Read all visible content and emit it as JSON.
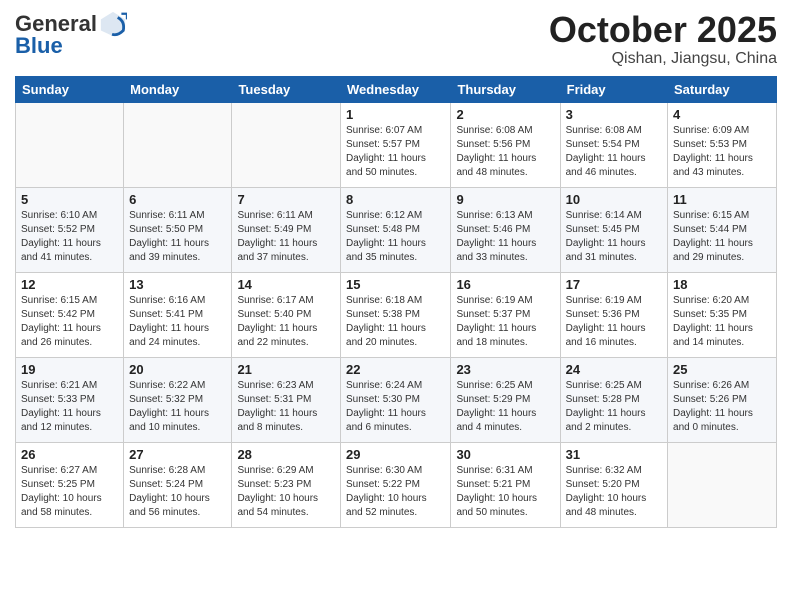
{
  "header": {
    "logo_general": "General",
    "logo_blue": "Blue",
    "month": "October 2025",
    "location": "Qishan, Jiangsu, China"
  },
  "days_of_week": [
    "Sunday",
    "Monday",
    "Tuesday",
    "Wednesday",
    "Thursday",
    "Friday",
    "Saturday"
  ],
  "weeks": [
    [
      {
        "day": "",
        "detail": ""
      },
      {
        "day": "",
        "detail": ""
      },
      {
        "day": "",
        "detail": ""
      },
      {
        "day": "1",
        "detail": "Sunrise: 6:07 AM\nSunset: 5:57 PM\nDaylight: 11 hours\nand 50 minutes."
      },
      {
        "day": "2",
        "detail": "Sunrise: 6:08 AM\nSunset: 5:56 PM\nDaylight: 11 hours\nand 48 minutes."
      },
      {
        "day": "3",
        "detail": "Sunrise: 6:08 AM\nSunset: 5:54 PM\nDaylight: 11 hours\nand 46 minutes."
      },
      {
        "day": "4",
        "detail": "Sunrise: 6:09 AM\nSunset: 5:53 PM\nDaylight: 11 hours\nand 43 minutes."
      }
    ],
    [
      {
        "day": "5",
        "detail": "Sunrise: 6:10 AM\nSunset: 5:52 PM\nDaylight: 11 hours\nand 41 minutes."
      },
      {
        "day": "6",
        "detail": "Sunrise: 6:11 AM\nSunset: 5:50 PM\nDaylight: 11 hours\nand 39 minutes."
      },
      {
        "day": "7",
        "detail": "Sunrise: 6:11 AM\nSunset: 5:49 PM\nDaylight: 11 hours\nand 37 minutes."
      },
      {
        "day": "8",
        "detail": "Sunrise: 6:12 AM\nSunset: 5:48 PM\nDaylight: 11 hours\nand 35 minutes."
      },
      {
        "day": "9",
        "detail": "Sunrise: 6:13 AM\nSunset: 5:46 PM\nDaylight: 11 hours\nand 33 minutes."
      },
      {
        "day": "10",
        "detail": "Sunrise: 6:14 AM\nSunset: 5:45 PM\nDaylight: 11 hours\nand 31 minutes."
      },
      {
        "day": "11",
        "detail": "Sunrise: 6:15 AM\nSunset: 5:44 PM\nDaylight: 11 hours\nand 29 minutes."
      }
    ],
    [
      {
        "day": "12",
        "detail": "Sunrise: 6:15 AM\nSunset: 5:42 PM\nDaylight: 11 hours\nand 26 minutes."
      },
      {
        "day": "13",
        "detail": "Sunrise: 6:16 AM\nSunset: 5:41 PM\nDaylight: 11 hours\nand 24 minutes."
      },
      {
        "day": "14",
        "detail": "Sunrise: 6:17 AM\nSunset: 5:40 PM\nDaylight: 11 hours\nand 22 minutes."
      },
      {
        "day": "15",
        "detail": "Sunrise: 6:18 AM\nSunset: 5:38 PM\nDaylight: 11 hours\nand 20 minutes."
      },
      {
        "day": "16",
        "detail": "Sunrise: 6:19 AM\nSunset: 5:37 PM\nDaylight: 11 hours\nand 18 minutes."
      },
      {
        "day": "17",
        "detail": "Sunrise: 6:19 AM\nSunset: 5:36 PM\nDaylight: 11 hours\nand 16 minutes."
      },
      {
        "day": "18",
        "detail": "Sunrise: 6:20 AM\nSunset: 5:35 PM\nDaylight: 11 hours\nand 14 minutes."
      }
    ],
    [
      {
        "day": "19",
        "detail": "Sunrise: 6:21 AM\nSunset: 5:33 PM\nDaylight: 11 hours\nand 12 minutes."
      },
      {
        "day": "20",
        "detail": "Sunrise: 6:22 AM\nSunset: 5:32 PM\nDaylight: 11 hours\nand 10 minutes."
      },
      {
        "day": "21",
        "detail": "Sunrise: 6:23 AM\nSunset: 5:31 PM\nDaylight: 11 hours\nand 8 minutes."
      },
      {
        "day": "22",
        "detail": "Sunrise: 6:24 AM\nSunset: 5:30 PM\nDaylight: 11 hours\nand 6 minutes."
      },
      {
        "day": "23",
        "detail": "Sunrise: 6:25 AM\nSunset: 5:29 PM\nDaylight: 11 hours\nand 4 minutes."
      },
      {
        "day": "24",
        "detail": "Sunrise: 6:25 AM\nSunset: 5:28 PM\nDaylight: 11 hours\nand 2 minutes."
      },
      {
        "day": "25",
        "detail": "Sunrise: 6:26 AM\nSunset: 5:26 PM\nDaylight: 11 hours\nand 0 minutes."
      }
    ],
    [
      {
        "day": "26",
        "detail": "Sunrise: 6:27 AM\nSunset: 5:25 PM\nDaylight: 10 hours\nand 58 minutes."
      },
      {
        "day": "27",
        "detail": "Sunrise: 6:28 AM\nSunset: 5:24 PM\nDaylight: 10 hours\nand 56 minutes."
      },
      {
        "day": "28",
        "detail": "Sunrise: 6:29 AM\nSunset: 5:23 PM\nDaylight: 10 hours\nand 54 minutes."
      },
      {
        "day": "29",
        "detail": "Sunrise: 6:30 AM\nSunset: 5:22 PM\nDaylight: 10 hours\nand 52 minutes."
      },
      {
        "day": "30",
        "detail": "Sunrise: 6:31 AM\nSunset: 5:21 PM\nDaylight: 10 hours\nand 50 minutes."
      },
      {
        "day": "31",
        "detail": "Sunrise: 6:32 AM\nSunset: 5:20 PM\nDaylight: 10 hours\nand 48 minutes."
      },
      {
        "day": "",
        "detail": ""
      }
    ]
  ]
}
